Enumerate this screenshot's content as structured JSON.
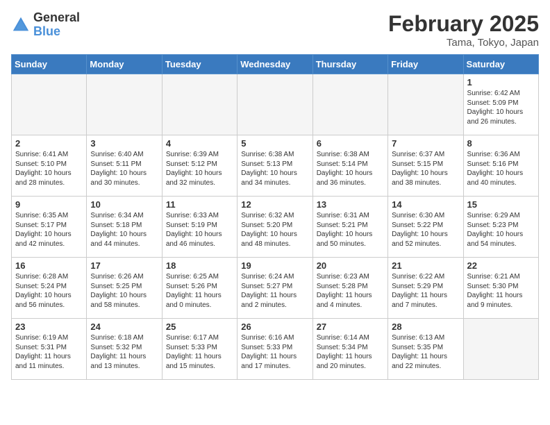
{
  "header": {
    "logo_line1": "General",
    "logo_line2": "Blue",
    "month_year": "February 2025",
    "location": "Tama, Tokyo, Japan"
  },
  "weekdays": [
    "Sunday",
    "Monday",
    "Tuesday",
    "Wednesday",
    "Thursday",
    "Friday",
    "Saturday"
  ],
  "weeks": [
    [
      {
        "num": "",
        "info": ""
      },
      {
        "num": "",
        "info": ""
      },
      {
        "num": "",
        "info": ""
      },
      {
        "num": "",
        "info": ""
      },
      {
        "num": "",
        "info": ""
      },
      {
        "num": "",
        "info": ""
      },
      {
        "num": "1",
        "info": "Sunrise: 6:42 AM\nSunset: 5:09 PM\nDaylight: 10 hours\nand 26 minutes."
      }
    ],
    [
      {
        "num": "2",
        "info": "Sunrise: 6:41 AM\nSunset: 5:10 PM\nDaylight: 10 hours\nand 28 minutes."
      },
      {
        "num": "3",
        "info": "Sunrise: 6:40 AM\nSunset: 5:11 PM\nDaylight: 10 hours\nand 30 minutes."
      },
      {
        "num": "4",
        "info": "Sunrise: 6:39 AM\nSunset: 5:12 PM\nDaylight: 10 hours\nand 32 minutes."
      },
      {
        "num": "5",
        "info": "Sunrise: 6:38 AM\nSunset: 5:13 PM\nDaylight: 10 hours\nand 34 minutes."
      },
      {
        "num": "6",
        "info": "Sunrise: 6:38 AM\nSunset: 5:14 PM\nDaylight: 10 hours\nand 36 minutes."
      },
      {
        "num": "7",
        "info": "Sunrise: 6:37 AM\nSunset: 5:15 PM\nDaylight: 10 hours\nand 38 minutes."
      },
      {
        "num": "8",
        "info": "Sunrise: 6:36 AM\nSunset: 5:16 PM\nDaylight: 10 hours\nand 40 minutes."
      }
    ],
    [
      {
        "num": "9",
        "info": "Sunrise: 6:35 AM\nSunset: 5:17 PM\nDaylight: 10 hours\nand 42 minutes."
      },
      {
        "num": "10",
        "info": "Sunrise: 6:34 AM\nSunset: 5:18 PM\nDaylight: 10 hours\nand 44 minutes."
      },
      {
        "num": "11",
        "info": "Sunrise: 6:33 AM\nSunset: 5:19 PM\nDaylight: 10 hours\nand 46 minutes."
      },
      {
        "num": "12",
        "info": "Sunrise: 6:32 AM\nSunset: 5:20 PM\nDaylight: 10 hours\nand 48 minutes."
      },
      {
        "num": "13",
        "info": "Sunrise: 6:31 AM\nSunset: 5:21 PM\nDaylight: 10 hours\nand 50 minutes."
      },
      {
        "num": "14",
        "info": "Sunrise: 6:30 AM\nSunset: 5:22 PM\nDaylight: 10 hours\nand 52 minutes."
      },
      {
        "num": "15",
        "info": "Sunrise: 6:29 AM\nSunset: 5:23 PM\nDaylight: 10 hours\nand 54 minutes."
      }
    ],
    [
      {
        "num": "16",
        "info": "Sunrise: 6:28 AM\nSunset: 5:24 PM\nDaylight: 10 hours\nand 56 minutes."
      },
      {
        "num": "17",
        "info": "Sunrise: 6:26 AM\nSunset: 5:25 PM\nDaylight: 10 hours\nand 58 minutes."
      },
      {
        "num": "18",
        "info": "Sunrise: 6:25 AM\nSunset: 5:26 PM\nDaylight: 11 hours\nand 0 minutes."
      },
      {
        "num": "19",
        "info": "Sunrise: 6:24 AM\nSunset: 5:27 PM\nDaylight: 11 hours\nand 2 minutes."
      },
      {
        "num": "20",
        "info": "Sunrise: 6:23 AM\nSunset: 5:28 PM\nDaylight: 11 hours\nand 4 minutes."
      },
      {
        "num": "21",
        "info": "Sunrise: 6:22 AM\nSunset: 5:29 PM\nDaylight: 11 hours\nand 7 minutes."
      },
      {
        "num": "22",
        "info": "Sunrise: 6:21 AM\nSunset: 5:30 PM\nDaylight: 11 hours\nand 9 minutes."
      }
    ],
    [
      {
        "num": "23",
        "info": "Sunrise: 6:19 AM\nSunset: 5:31 PM\nDaylight: 11 hours\nand 11 minutes."
      },
      {
        "num": "24",
        "info": "Sunrise: 6:18 AM\nSunset: 5:32 PM\nDaylight: 11 hours\nand 13 minutes."
      },
      {
        "num": "25",
        "info": "Sunrise: 6:17 AM\nSunset: 5:33 PM\nDaylight: 11 hours\nand 15 minutes."
      },
      {
        "num": "26",
        "info": "Sunrise: 6:16 AM\nSunset: 5:33 PM\nDaylight: 11 hours\nand 17 minutes."
      },
      {
        "num": "27",
        "info": "Sunrise: 6:14 AM\nSunset: 5:34 PM\nDaylight: 11 hours\nand 20 minutes."
      },
      {
        "num": "28",
        "info": "Sunrise: 6:13 AM\nSunset: 5:35 PM\nDaylight: 11 hours\nand 22 minutes."
      },
      {
        "num": "",
        "info": ""
      }
    ]
  ]
}
